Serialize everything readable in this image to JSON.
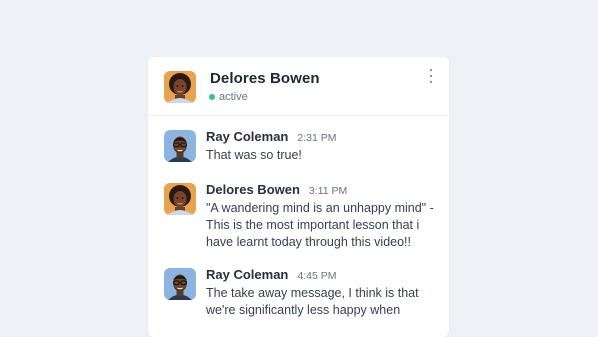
{
  "header": {
    "name": "Delores Bowen",
    "status": "active",
    "status_color": "#34c77b",
    "menu_icon": "kebab-menu-icon"
  },
  "messages": [
    {
      "author": "Ray Coleman",
      "time": "2:31 PM",
      "text": "That was so true!"
    },
    {
      "author": "Delores Bowen",
      "time": "3:11 PM",
      "text": "\"A wandering mind is an unhappy mind\" -This is the most important lesson that i have learnt today through this video!!"
    },
    {
      "author": "Ray Coleman",
      "time": "4:45 PM",
      "text": "The take away message, I think is that we're significantly less happy when"
    }
  ]
}
